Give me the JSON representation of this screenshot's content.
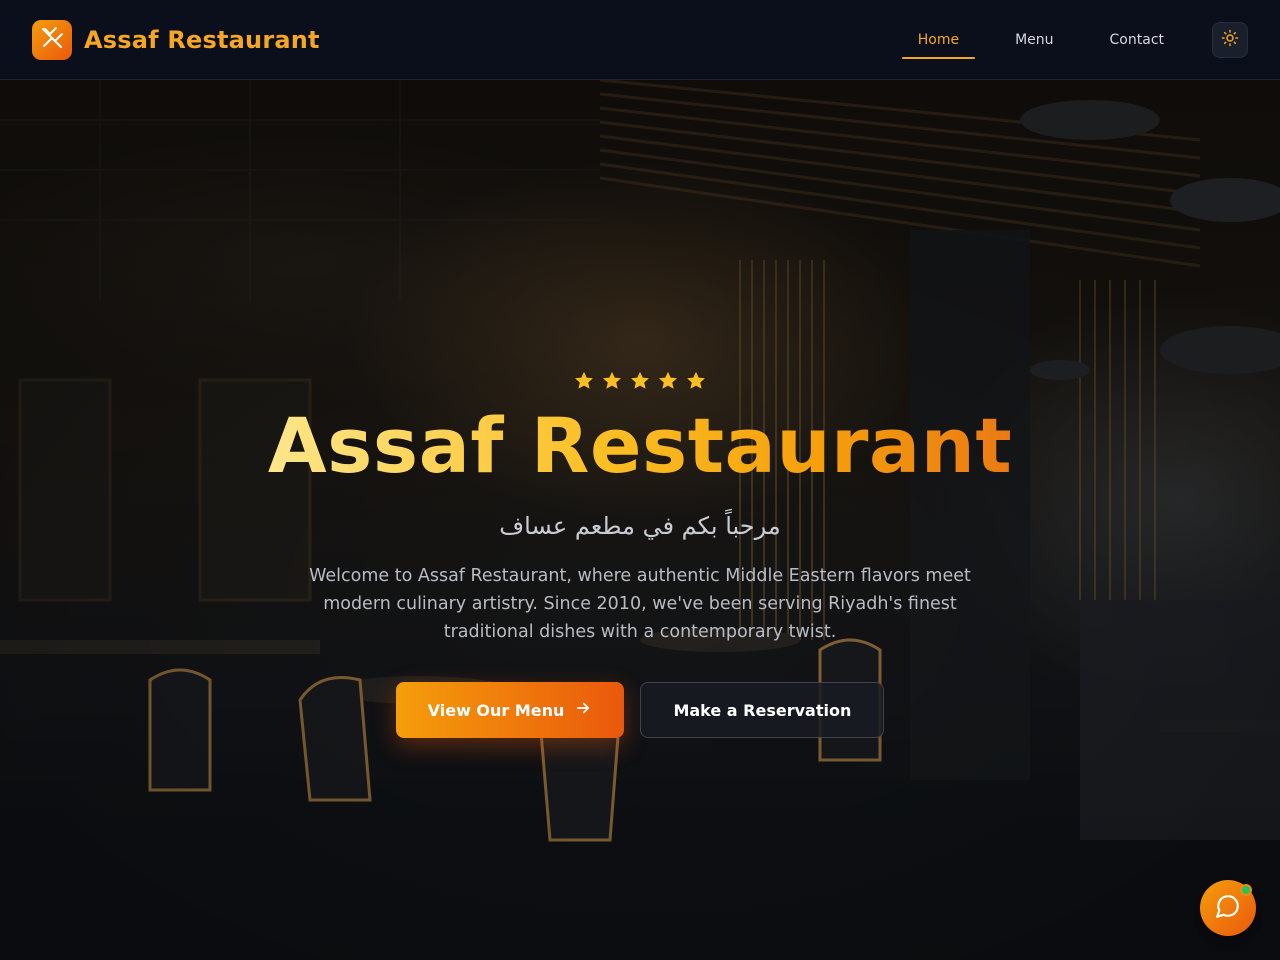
{
  "header": {
    "brand": "Assaf Restaurant",
    "logo_icon": "utensils-crossed-icon",
    "nav": [
      {
        "label": "Home",
        "active": true
      },
      {
        "label": "Menu",
        "active": false
      },
      {
        "label": "Contact",
        "active": false
      }
    ],
    "theme_toggle_icon": "sun-icon"
  },
  "hero": {
    "rating_stars": 5,
    "title": "Assaf Restaurant",
    "subtitle_arabic": "مرحباً بكم في مطعم عساف",
    "description": "Welcome to Assaf Restaurant, where authentic Middle Eastern flavors meet modern culinary artistry. Since 2010, we've been serving Riyadh's finest traditional dishes with a contemporary twist.",
    "primary_cta": "View Our Menu",
    "primary_cta_icon": "arrow-right-icon",
    "secondary_cta": "Make a Reservation"
  },
  "chat": {
    "icon": "chat-bubble-icon",
    "status": "online"
  },
  "colors": {
    "accent": "#f5a623",
    "accent_gradient_start": "#f59e0b",
    "accent_gradient_end": "#ea580c",
    "header_bg": "#0b0f1c",
    "online": "#22c55e"
  }
}
